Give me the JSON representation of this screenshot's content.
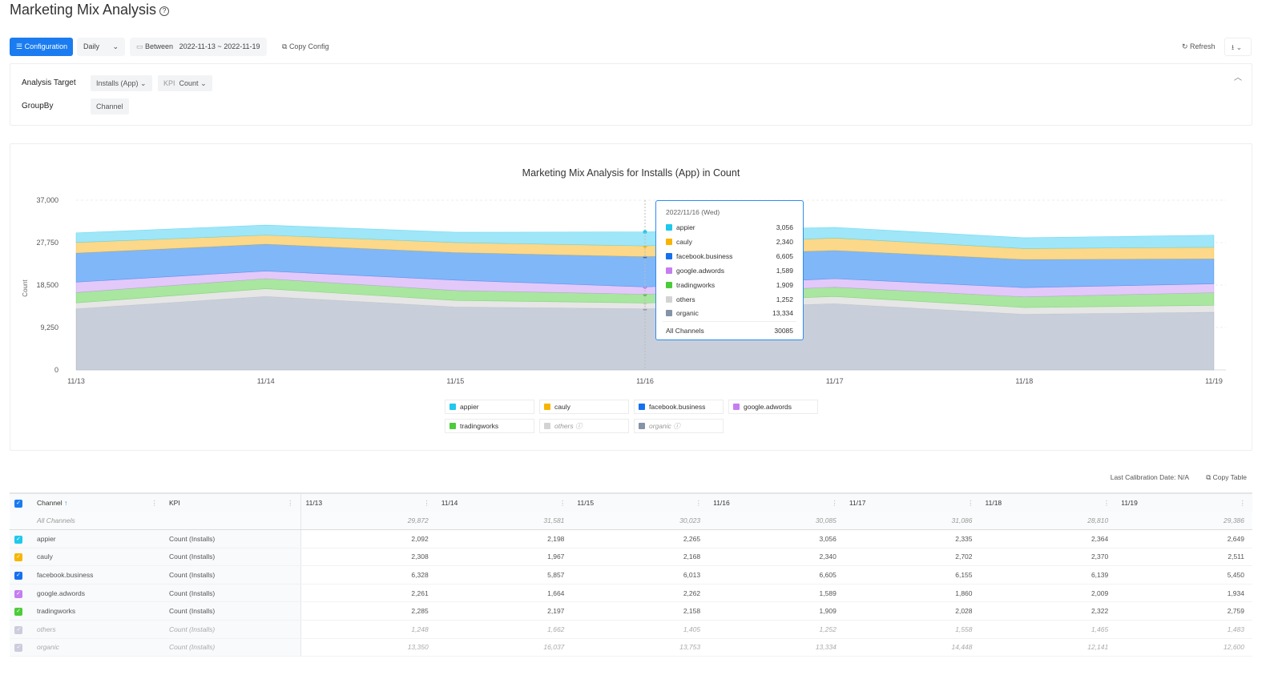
{
  "page": {
    "title": "Marketing Mix Analysis"
  },
  "toolbar": {
    "configuration": "Configuration",
    "granularity": "Daily",
    "between_label": "Between",
    "date_range": "2022-11-13 ~ 2022-11-19",
    "copy_config": "Copy Config",
    "refresh": "Refresh"
  },
  "config": {
    "analysis_target_label": "Analysis Target",
    "target": "Installs (App)",
    "kpi_label": "KPI",
    "kpi": "Count",
    "groupby_label": "GroupBy",
    "groupby": "Channel"
  },
  "chart_data": {
    "type": "area",
    "stacked": true,
    "title": "Marketing Mix Analysis for Installs (App) in Count",
    "ylabel": "Count",
    "ylim": [
      0,
      37000
    ],
    "yticks": [
      "0",
      "9,250",
      "18,500",
      "27,750",
      "37,000"
    ],
    "categories": [
      "11/13",
      "11/14",
      "11/15",
      "11/16",
      "11/17",
      "11/18",
      "11/19"
    ],
    "series": [
      {
        "name": "appier",
        "color": "#1fc8ec",
        "fill": "#9fe6f8",
        "values": [
          2092,
          2198,
          2265,
          3056,
          2335,
          2364,
          2649
        ]
      },
      {
        "name": "cauly",
        "color": "#f7b500",
        "fill": "#fbd88a",
        "values": [
          2308,
          1967,
          2168,
          2340,
          2702,
          2370,
          2511
        ]
      },
      {
        "name": "facebook.business",
        "color": "#1570ef",
        "fill": "#80b7f8",
        "values": [
          6328,
          5857,
          6013,
          6605,
          6155,
          6139,
          5450
        ]
      },
      {
        "name": "google.adwords",
        "color": "#c57ef0",
        "fill": "#e2c9fa",
        "values": [
          2261,
          1664,
          2262,
          1589,
          1860,
          2009,
          1934
        ]
      },
      {
        "name": "tradingworks",
        "color": "#4ccc3a",
        "fill": "#a9e6a0",
        "values": [
          2285,
          2197,
          2158,
          1909,
          2028,
          2322,
          2759
        ]
      },
      {
        "name": "others",
        "color": "#d3d3d3",
        "fill": "#e6e6e6",
        "values": [
          1248,
          1662,
          1405,
          1252,
          1558,
          1465,
          1483
        ]
      },
      {
        "name": "organic",
        "color": "#8593a6",
        "fill": "#c8cfda",
        "values": [
          13350,
          16037,
          13753,
          13334,
          14448,
          12141,
          12600
        ]
      }
    ],
    "legend_placement": "bottom",
    "tooltip": {
      "date": "2022/11/16 (Wed)",
      "rows": [
        {
          "name": "appier",
          "value": "3,056"
        },
        {
          "name": "cauly",
          "value": "2,340"
        },
        {
          "name": "facebook.business",
          "value": "6,605"
        },
        {
          "name": "google.adwords",
          "value": "1,589"
        },
        {
          "name": "tradingworks",
          "value": "1,909"
        },
        {
          "name": "others",
          "value": "1,252"
        },
        {
          "name": "organic",
          "value": "13,334"
        }
      ],
      "total_label": "All Channels",
      "total": "30085"
    }
  },
  "table": {
    "calibration": "Last Calibration Date: N/A",
    "copy_table": "Copy Table",
    "headers": [
      "Channel",
      "KPI",
      "11/13",
      "11/14",
      "11/15",
      "11/16",
      "11/17",
      "11/18",
      "11/19"
    ],
    "all_row": {
      "label": "All Channels",
      "values": [
        "29,872",
        "31,581",
        "30,023",
        "30,085",
        "31,086",
        "28,810",
        "29,386"
      ]
    },
    "rows": [
      {
        "channel": "appier",
        "kpi": "Count (Installs)",
        "values": [
          "2,092",
          "2,198",
          "2,265",
          "3,056",
          "2,335",
          "2,364",
          "2,649"
        ]
      },
      {
        "channel": "cauly",
        "kpi": "Count (Installs)",
        "values": [
          "2,308",
          "1,967",
          "2,168",
          "2,340",
          "2,702",
          "2,370",
          "2,511"
        ]
      },
      {
        "channel": "facebook.business",
        "kpi": "Count (Installs)",
        "values": [
          "6,328",
          "5,857",
          "6,013",
          "6,605",
          "6,155",
          "6,139",
          "5,450"
        ]
      },
      {
        "channel": "google.adwords",
        "kpi": "Count (Installs)",
        "values": [
          "2,261",
          "1,664",
          "2,262",
          "1,589",
          "1,860",
          "2,009",
          "1,934"
        ]
      },
      {
        "channel": "tradingworks",
        "kpi": "Count (Installs)",
        "values": [
          "2,285",
          "2,197",
          "2,158",
          "1,909",
          "2,028",
          "2,322",
          "2,759"
        ]
      },
      {
        "channel": "others",
        "kpi": "Count (Installs)",
        "values": [
          "1,248",
          "1,662",
          "1,405",
          "1,252",
          "1,558",
          "1,465",
          "1,483"
        ]
      },
      {
        "channel": "organic",
        "kpi": "Count (Installs)",
        "values": [
          "13,350",
          "16,037",
          "13,753",
          "13,334",
          "14,448",
          "12,141",
          "12,600"
        ]
      }
    ]
  }
}
